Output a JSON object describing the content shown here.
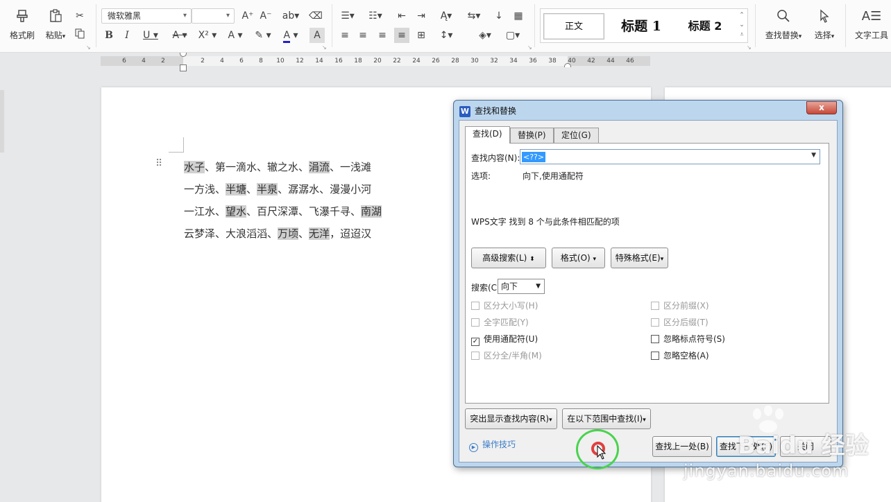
{
  "ribbon": {
    "format_painter": "格式刷",
    "paste": "粘贴",
    "font_name": "微软雅黑",
    "font_size": "",
    "styles": [
      "正文",
      "标题 1",
      "标题 2"
    ],
    "find_replace": "查找替换",
    "select": "选择",
    "text_tools": "文字工具"
  },
  "ruler": {
    "ticks": [
      "6",
      "4",
      "2",
      "2",
      "4",
      "6",
      "8",
      "10",
      "12",
      "14",
      "16",
      "18",
      "20",
      "22",
      "24",
      "26",
      "28",
      "30",
      "32",
      "34",
      "36",
      "38",
      "40",
      "42",
      "44",
      "46"
    ]
  },
  "document": {
    "lines": [
      [
        {
          "t": "水子",
          "h": true
        },
        {
          "t": "、第一滴水、辙之水、"
        },
        {
          "t": "涓流",
          "h": true
        },
        {
          "t": "、一浅滩"
        }
      ],
      [
        {
          "t": "一方浅、"
        },
        {
          "t": "半塘",
          "h": true
        },
        {
          "t": "、"
        },
        {
          "t": "半泉",
          "h": true
        },
        {
          "t": "、潺潺水、漫漫小河"
        }
      ],
      [
        {
          "t": "一江水、"
        },
        {
          "t": "望水",
          "h": true
        },
        {
          "t": "、百尺深潭、飞瀑千寻、"
        },
        {
          "t": "南湖",
          "h": true
        }
      ],
      [
        {
          "t": "云梦泽、大浪滔滔、"
        },
        {
          "t": "万顷",
          "h": true
        },
        {
          "t": "、"
        },
        {
          "t": "无洋",
          "h": true
        },
        {
          "t": "，迢迢汉"
        }
      ]
    ]
  },
  "dialog": {
    "title": "查找和替换",
    "close": "x",
    "tabs": [
      "查找(D)",
      "替换(P)",
      "定位(G)"
    ],
    "find_label": "查找内容(N):",
    "find_value": "<??>",
    "options_label": "选项:",
    "options_value": "向下,使用通配符",
    "result_message": "WPS文字 找到 8 个与此条件相匹配的项",
    "advanced_button": "高级搜索(L)",
    "format_button": "格式(O)",
    "special_button": "特殊格式(E)",
    "search_label": "搜索(C)",
    "search_direction": "向下",
    "checkboxes_left": [
      {
        "label": "区分大小写(H)",
        "checked": false,
        "enabled": false
      },
      {
        "label": "全字匹配(Y)",
        "checked": false,
        "enabled": false
      },
      {
        "label": "使用通配符(U)",
        "checked": true,
        "enabled": true
      },
      {
        "label": "区分全/半角(M)",
        "checked": false,
        "enabled": false
      }
    ],
    "checkboxes_right": [
      {
        "label": "区分前缀(X)",
        "checked": false,
        "enabled": false
      },
      {
        "label": "区分后缀(T)",
        "checked": false,
        "enabled": false
      },
      {
        "label": "忽略标点符号(S)",
        "checked": false,
        "enabled": true
      },
      {
        "label": "忽略空格(A)",
        "checked": false,
        "enabled": true
      }
    ],
    "highlight_button": "突出显示查找内容(R)",
    "find_in_button": "在以下范围中查找(I)",
    "tips_link": "操作技巧",
    "find_prev_button": "查找上一处(B)",
    "find_next_button": "查找下一处(F)",
    "close_button": "关闭"
  },
  "watermark": {
    "logo": "Baidu 经验",
    "url": "jingyan.baidu.com"
  }
}
